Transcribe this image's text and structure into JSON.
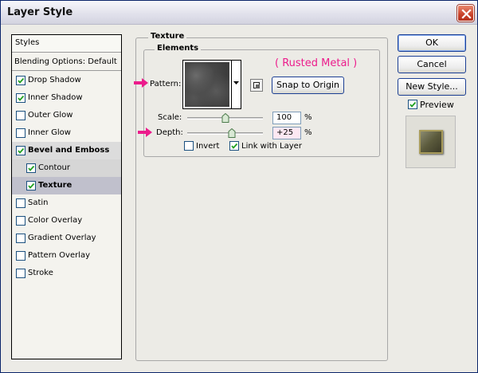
{
  "window": {
    "title": "Layer Style"
  },
  "styles_list": {
    "header": "Styles",
    "items": [
      {
        "label": "Blending Options: Default",
        "checkbox": false,
        "checked": false,
        "bold": false
      },
      {
        "label": "Drop Shadow",
        "checkbox": true,
        "checked": true,
        "bold": false
      },
      {
        "label": "Inner Shadow",
        "checkbox": true,
        "checked": true,
        "bold": false
      },
      {
        "label": "Outer Glow",
        "checkbox": true,
        "checked": false,
        "bold": false
      },
      {
        "label": "Inner Glow",
        "checkbox": true,
        "checked": false,
        "bold": false
      },
      {
        "label": "Bevel and Emboss",
        "checkbox": true,
        "checked": true,
        "bold": true
      },
      {
        "label": "Contour",
        "checkbox": true,
        "checked": true,
        "bold": false
      },
      {
        "label": "Texture",
        "checkbox": true,
        "checked": true,
        "bold": true
      },
      {
        "label": "Satin",
        "checkbox": true,
        "checked": false,
        "bold": false
      },
      {
        "label": "Color Overlay",
        "checkbox": true,
        "checked": false,
        "bold": false
      },
      {
        "label": "Gradient Overlay",
        "checkbox": true,
        "checked": false,
        "bold": false
      },
      {
        "label": "Pattern Overlay",
        "checkbox": true,
        "checked": false,
        "bold": false
      },
      {
        "label": "Stroke",
        "checkbox": true,
        "checked": false,
        "bold": false
      }
    ]
  },
  "texture_panel": {
    "group_title": "Texture",
    "elements_title": "Elements",
    "pattern_label": "Pattern:",
    "annotation": "( Rusted Metal )",
    "snap_button": "Snap to Origin",
    "scale_label": "Scale:",
    "scale_value": "100",
    "scale_unit": "%",
    "depth_label": "Depth:",
    "depth_value": "+25",
    "depth_unit": "%",
    "invert_label": "Invert",
    "invert_checked": false,
    "link_label": "Link with Layer",
    "link_checked": true
  },
  "buttons": {
    "ok": "OK",
    "cancel": "Cancel",
    "new_style": "New Style...",
    "preview_label": "Preview",
    "preview_checked": true
  },
  "colors": {
    "annotation": "#ec1c8c",
    "arrow": "#ec1c8c",
    "selection": "#c0c0cc"
  }
}
